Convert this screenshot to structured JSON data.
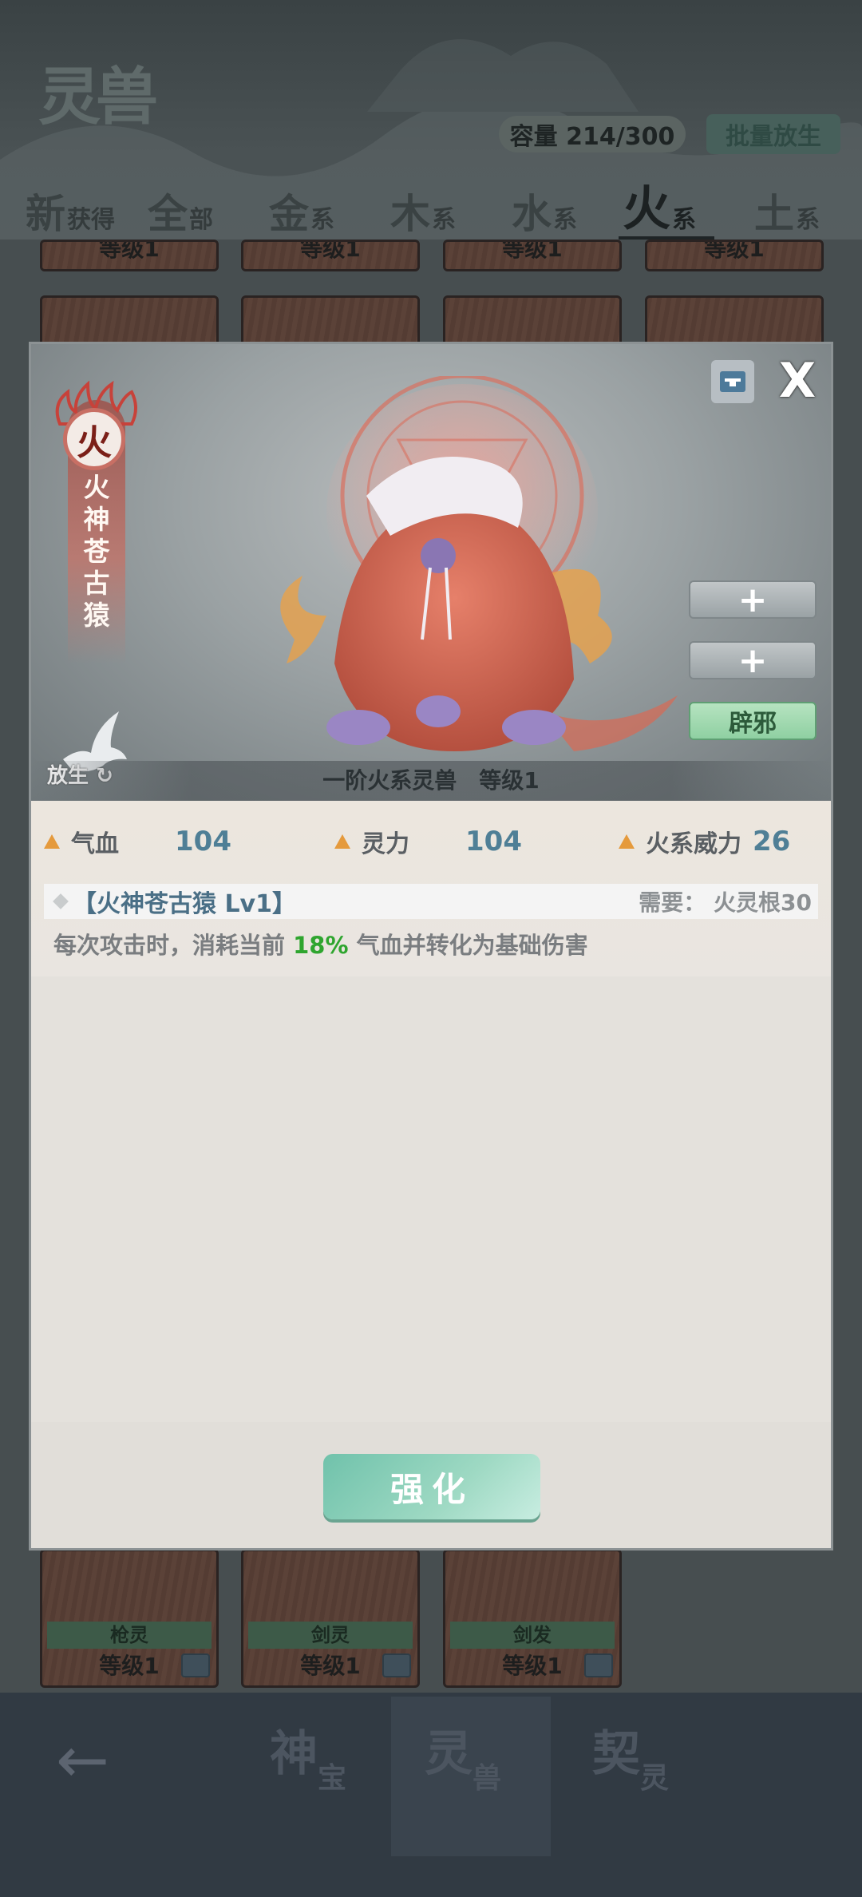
{
  "header": {
    "logo_text": "灵兽",
    "capacity": "容量 214/300",
    "batch_release": "批量放生"
  },
  "tabs": [
    {
      "big": "新",
      "small": "获得"
    },
    {
      "big": "全",
      "small": "部"
    },
    {
      "big": "金",
      "small": "系"
    },
    {
      "big": "木",
      "small": "系"
    },
    {
      "big": "水",
      "small": "系"
    },
    {
      "big": "火",
      "small": "系"
    },
    {
      "big": "土",
      "small": "系"
    }
  ],
  "active_tab_index": 5,
  "grid": {
    "top_row_level": "等级1",
    "bottom_row": [
      {
        "name": "枪灵",
        "level": "等级1"
      },
      {
        "name": "剑灵",
        "level": "等级1"
      },
      {
        "name": "剑发",
        "level": "等级1"
      }
    ]
  },
  "modal": {
    "element": "火",
    "beast_name": "火神苍古猿",
    "caption_rank": "一阶火系灵兽",
    "caption_level": "等级1",
    "side_buttons": [
      "+",
      "+",
      "辟邪"
    ],
    "release_label": "放生",
    "stats": [
      {
        "label": "气血",
        "value": "104"
      },
      {
        "label": "灵力",
        "value": "104"
      },
      {
        "label": "火系威力",
        "value": "26"
      }
    ],
    "skill": {
      "name": "【火神苍古猿 Lv1】",
      "requirement": "需要：  火灵根30",
      "desc_before": "每次攻击时，消耗当前",
      "desc_highlight": "18%",
      "desc_after": "气血并转化为基础伤害"
    },
    "enhance_label": "强化",
    "close_label": "X"
  },
  "bottom_nav": [
    {
      "big": "神",
      "small": "宝"
    },
    {
      "big": "灵",
      "small": "兽"
    },
    {
      "big": "契",
      "small": "灵"
    }
  ],
  "colors": {
    "accent_green": "#2fa52f",
    "stat_value": "#4f7f96",
    "button_teal": "#70c2ab"
  }
}
